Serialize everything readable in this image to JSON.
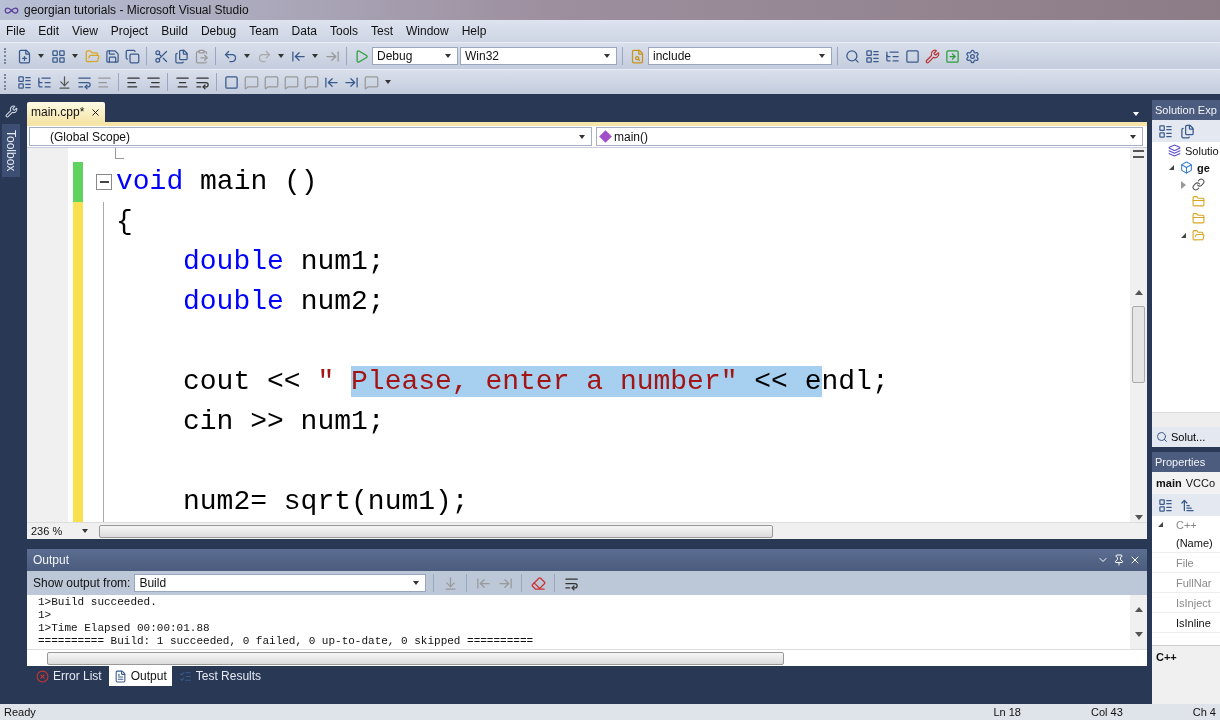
{
  "window": {
    "title": "georgian tutorials - Microsoft Visual Studio"
  },
  "menu": [
    "File",
    "Edit",
    "View",
    "Project",
    "Build",
    "Debug",
    "Team",
    "Data",
    "Tools",
    "Test",
    "Window",
    "Help"
  ],
  "toolbar": {
    "configuration": "Debug",
    "platform": "Win32",
    "find": "include"
  },
  "toolbox_tab": "Toolbox",
  "editor": {
    "tabs": [
      {
        "label": "main.cpp*",
        "selected": true
      }
    ],
    "scope": "(Global Scope)",
    "member": "main()",
    "zoom": "236 %",
    "lines": [
      {
        "saved": true,
        "collapse": true,
        "indented": false,
        "segments": [
          {
            "text": "void",
            "kind": "keyword",
            "selected": false
          },
          {
            "text": " main ()",
            "kind": "plain",
            "selected": false
          }
        ]
      },
      {
        "saved": false,
        "collapse": false,
        "indented": false,
        "segments": [
          {
            "text": "{",
            "kind": "plain",
            "selected": false
          }
        ]
      },
      {
        "saved": false,
        "collapse": false,
        "indented": true,
        "segments": [
          {
            "text": "double",
            "kind": "keyword",
            "selected": false
          },
          {
            "text": " num1;",
            "kind": "plain",
            "selected": false
          }
        ]
      },
      {
        "saved": false,
        "collapse": false,
        "indented": true,
        "segments": [
          {
            "text": "double",
            "kind": "keyword",
            "selected": false
          },
          {
            "text": " num2;",
            "kind": "plain",
            "selected": false
          }
        ]
      },
      {
        "saved": false
      },
      {
        "saved": false,
        "collapse": false,
        "indented": true,
        "segments": [
          {
            "text": "cout << ",
            "kind": "plain",
            "selected": false
          },
          {
            "text": "\" ",
            "kind": "string",
            "selected": false
          },
          {
            "text": "Please, enter a number\"",
            "kind": "string",
            "selected": true
          },
          {
            "text": " << e",
            "kind": "plain",
            "selected": true
          },
          {
            "text": "ndl;",
            "kind": "plain",
            "selected": false
          }
        ]
      },
      {
        "saved": false,
        "collapse": false,
        "indented": true,
        "segments": [
          {
            "text": "cin >> num1;",
            "kind": "plain",
            "selected": false
          }
        ]
      },
      {
        "saved": false
      },
      {
        "saved": false,
        "collapse": false,
        "indented": true,
        "segments": [
          {
            "text": "num2= sqrt(num1);",
            "kind": "plain",
            "selected": false
          }
        ]
      }
    ]
  },
  "output": {
    "title": "Output",
    "source_label": "Show output from:",
    "source": "Build",
    "lines": [
      "1>Build succeeded.",
      "1>",
      "1>Time Elapsed 00:00:01.88",
      "========== Build: 1 succeeded, 0 failed, 0 up-to-date, 0 skipped =========="
    ]
  },
  "bottom_tabs": [
    {
      "label": "Error List",
      "kind": "errors",
      "selected": false
    },
    {
      "label": "Output",
      "kind": "output",
      "selected": true
    },
    {
      "label": "Test Results",
      "kind": "tests",
      "selected": false
    }
  ],
  "solution_explorer": {
    "title": "Solution Exp",
    "tree": [
      {
        "label": "Solutio",
        "kind": "solution",
        "children": [
          {
            "label": "ge",
            "kind": "project",
            "expanded": true,
            "children": [
              {
                "kind": "references",
                "expanded": false
              },
              {
                "kind": "folder"
              },
              {
                "kind": "folder"
              },
              {
                "kind": "open-folder",
                "expanded": true
              }
            ]
          }
        ]
      }
    ],
    "footer_tab": "Solut..."
  },
  "properties": {
    "title": "Properties",
    "object": "main",
    "object_type": "VCCo",
    "category": "C++",
    "rows": [
      {
        "label": "(Name)",
        "enabled": true
      },
      {
        "label": "File",
        "enabled": false
      },
      {
        "label": "FullNar",
        "enabled": false
      },
      {
        "label": "IsInject",
        "enabled": false
      },
      {
        "label": "IsInline",
        "enabled": true
      }
    ],
    "description": "C++"
  },
  "status_bar": {
    "message": "Ready",
    "line": "Ln 18",
    "column": "Col 43",
    "char": "Ch 4"
  }
}
